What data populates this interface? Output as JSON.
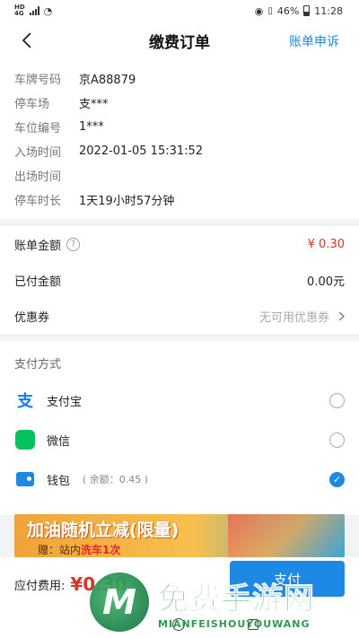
{
  "status_bar": {
    "net_tag_top": "HD",
    "net_tag_bottom": "4G",
    "battery": "46%",
    "time": "11:28"
  },
  "nav": {
    "title": "缴费订单",
    "action": "账单申诉"
  },
  "order_info": [
    {
      "label": "车牌号码",
      "value": "京A88879"
    },
    {
      "label": "停车场",
      "value": "支***"
    },
    {
      "label": "车位编号",
      "value": "1***"
    },
    {
      "label": "入场时间",
      "value": "2022-01-05 15:31:52"
    },
    {
      "label": "出场时间",
      "value": ""
    },
    {
      "label": "停车时长",
      "value": "1天19小时57分钟"
    }
  ],
  "amounts": {
    "bill_label": "账单金额",
    "bill_value": "¥ 0.30",
    "paid_label": "已付金额",
    "paid_value": "0.00元",
    "coupon_label": "优惠券",
    "coupon_value": "无可用优惠券"
  },
  "payment": {
    "section_title": "支付方式",
    "methods": [
      {
        "icon": "alipay-icon",
        "label": "支付宝",
        "note": "",
        "selected": false
      },
      {
        "icon": "wechat-icon",
        "label": "微信",
        "note": "",
        "selected": false
      },
      {
        "icon": "wallet-icon",
        "label": "钱包",
        "note": "( 余额：0.45 )",
        "selected": true
      }
    ]
  },
  "banner": {
    "title": "加油随机立减(限量)",
    "sub_prefix": "赠：站内",
    "sub_highlight": "洗车1次"
  },
  "bottom": {
    "due_label": "应付费用:",
    "due_amount": "¥0.30",
    "pay_button": "支付"
  },
  "watermark": {
    "logo_letter": "M",
    "cn": "免费手游网",
    "en": "MIANFEISHOUYOUWANG"
  },
  "colors": {
    "accent": "#1e88e5",
    "price_red": "#d9342b"
  }
}
